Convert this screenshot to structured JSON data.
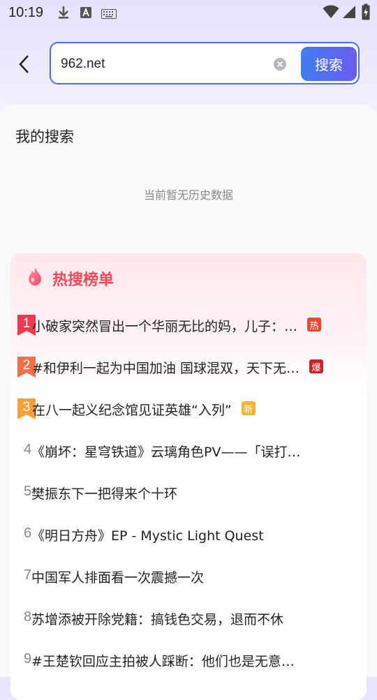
{
  "status_bar": {
    "time": "10:19",
    "left_icons": [
      "download-icon",
      "font-a-icon",
      "keyboard-icon"
    ],
    "right_icons": [
      "wifi-icon",
      "signal-icon",
      "battery-charging-icon"
    ]
  },
  "search": {
    "value": "962.net",
    "button_label": "搜索"
  },
  "history": {
    "title": "我的搜索",
    "empty_text": "当前暂无历史数据"
  },
  "hot": {
    "title": "热搜榜单",
    "items": [
      {
        "rank": "1",
        "text": "小破家突然冒出一个华丽无比的妈，儿子：…",
        "tag": "热",
        "tag_color": "#e84a2f",
        "badge_color": "#f0384f"
      },
      {
        "rank": "2",
        "text": "#和伊利一起为中国加油 国球混双，天下无…",
        "tag": "爆",
        "tag_color": "#c9242b",
        "badge_color": "#f2704a"
      },
      {
        "rank": "3",
        "text": "在八一起义纪念馆见证英雄“入列”",
        "tag": "新",
        "tag_color": "#f5b236",
        "badge_color": "#f7a136"
      },
      {
        "rank": "4",
        "text": "《崩坏：星穹铁道》云璃角色PV——「误打…"
      },
      {
        "rank": "5",
        "text": "樊振东下一把得来个十环"
      },
      {
        "rank": "6",
        "text": "《明日方舟》EP - Mystic Light Quest"
      },
      {
        "rank": "7",
        "text": "中国军人排面看一次震撼一次"
      },
      {
        "rank": "8",
        "text": "苏增添被开除党籍：搞钱色交易，退而不休"
      },
      {
        "rank": "9",
        "text": "#王楚钦回应主拍被人踩断：他们也是无意…"
      }
    ]
  },
  "colors": {
    "accent": "#4e6cf0",
    "hot_title": "#ef4a5a"
  }
}
